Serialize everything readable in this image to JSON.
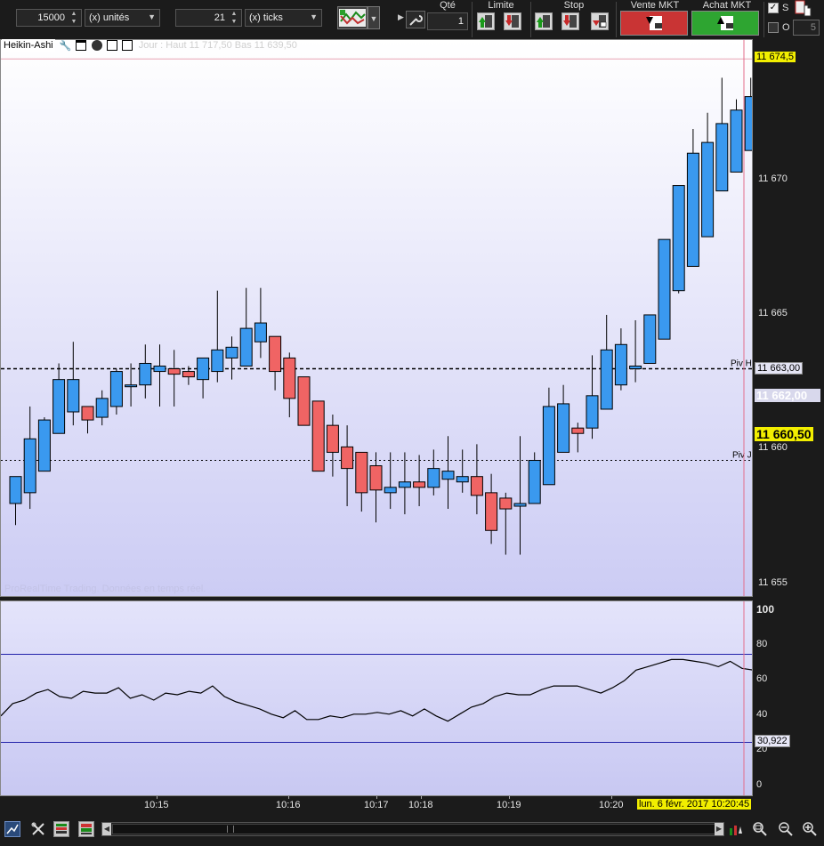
{
  "toolbar": {
    "quantity": "15000",
    "quantity_unit": "(x) unités",
    "ticks": "21",
    "ticks_unit": "(x) ticks",
    "qte_label": "Qté",
    "qte_value": "1",
    "limite_label": "Limite",
    "stop_label": "Stop",
    "vente_label": "Vente MKT",
    "achat_label": "Achat MKT",
    "s_label": "S",
    "o_label": "O",
    "o_value": "5"
  },
  "chart": {
    "indicator_title": "Heikin-Ashi",
    "header_info": "Jour : Haut 11 717,50  Bas 11 639,50",
    "watermark": "ProRealTime Trading. Données en temps réel.",
    "price_labels": [
      {
        "text": "11 674,5",
        "price": 11674.5,
        "style": "last-high"
      },
      {
        "text": "11 670",
        "price": 11670
      },
      {
        "text": "11 665",
        "price": 11665
      },
      {
        "text": "11 663,00",
        "price": 11663.0,
        "style": "pivot"
      },
      {
        "text": "11 662,00",
        "price": 11662.0,
        "style": "ghost"
      },
      {
        "text": "11 660,50",
        "price": 11660.5,
        "style": "current"
      },
      {
        "text": "11 660",
        "price": 11660
      },
      {
        "text": "11 655",
        "price": 11655
      }
    ],
    "pivot_high_label": "Piv H",
    "pivot_high_value": 11663.0,
    "pivot_low_label": "Piv J",
    "pivot_low_value": 11659.6,
    "osc_labels": [
      "100",
      "80",
      "60",
      "40",
      "20",
      "0"
    ],
    "osc_current": "30,922",
    "time_labels": [
      "10:15",
      "10:16",
      "10:17",
      "10:18",
      "10:19",
      "10:20"
    ],
    "current_time": "lun. 6 févr. 2017 10:20:45",
    "colors": {
      "up": "#3a99ef",
      "down": "#f06464",
      "pivot": "#000000",
      "cursor": "#e36d8b",
      "osc_line": "#000000",
      "osc_band": "#2222aa"
    }
  },
  "chart_data": {
    "type": "candlestick",
    "title": "Heikin-Ashi",
    "ylim": [
      11654.5,
      11675.2
    ],
    "candles": [
      {
        "o": 11658.0,
        "h": 11659.0,
        "l": 11657.2,
        "c": 11659.0
      },
      {
        "o": 11658.4,
        "h": 11661.6,
        "l": 11657.8,
        "c": 11660.4
      },
      {
        "o": 11659.2,
        "h": 11661.2,
        "l": 11659.2,
        "c": 11661.1
      },
      {
        "o": 11660.6,
        "h": 11663.2,
        "l": 11660.6,
        "c": 11662.6
      },
      {
        "o": 11661.4,
        "h": 11664.0,
        "l": 11660.9,
        "c": 11662.6
      },
      {
        "o": 11661.6,
        "h": 11661.6,
        "l": 11660.6,
        "c": 11661.1
      },
      {
        "o": 11661.2,
        "h": 11662.2,
        "l": 11660.9,
        "c": 11661.9
      },
      {
        "o": 11661.6,
        "h": 11663.0,
        "l": 11661.3,
        "c": 11662.9
      },
      {
        "o": 11662.4,
        "h": 11663.2,
        "l": 11661.6,
        "c": 11662.4
      },
      {
        "o": 11662.4,
        "h": 11663.9,
        "l": 11661.9,
        "c": 11663.2
      },
      {
        "o": 11662.9,
        "h": 11663.9,
        "l": 11661.6,
        "c": 11663.1
      },
      {
        "o": 11663.0,
        "h": 11663.7,
        "l": 11661.6,
        "c": 11662.8
      },
      {
        "o": 11662.9,
        "h": 11663.1,
        "l": 11662.4,
        "c": 11662.7
      },
      {
        "o": 11662.6,
        "h": 11663.3,
        "l": 11661.9,
        "c": 11663.4
      },
      {
        "o": 11662.9,
        "h": 11665.9,
        "l": 11662.5,
        "c": 11663.7
      },
      {
        "o": 11663.4,
        "h": 11664.2,
        "l": 11662.6,
        "c": 11663.8
      },
      {
        "o": 11663.1,
        "h": 11666.0,
        "l": 11663.1,
        "c": 11664.5
      },
      {
        "o": 11664.0,
        "h": 11666.0,
        "l": 11663.4,
        "c": 11664.7
      },
      {
        "o": 11664.2,
        "h": 11664.2,
        "l": 11662.2,
        "c": 11662.9
      },
      {
        "o": 11663.4,
        "h": 11663.6,
        "l": 11661.2,
        "c": 11661.9
      },
      {
        "o": 11662.7,
        "h": 11662.7,
        "l": 11660.9,
        "c": 11660.9
      },
      {
        "o": 11661.8,
        "h": 11661.8,
        "l": 11659.2,
        "c": 11659.2
      },
      {
        "o": 11660.9,
        "h": 11661.3,
        "l": 11659.0,
        "c": 11659.9
      },
      {
        "o": 11660.1,
        "h": 11660.9,
        "l": 11657.9,
        "c": 11659.3
      },
      {
        "o": 11659.9,
        "h": 11659.9,
        "l": 11657.7,
        "c": 11658.4
      },
      {
        "o": 11659.4,
        "h": 11659.9,
        "l": 11657.3,
        "c": 11658.5
      },
      {
        "o": 11658.4,
        "h": 11659.9,
        "l": 11657.8,
        "c": 11658.6
      },
      {
        "o": 11658.6,
        "h": 11659.9,
        "l": 11657.6,
        "c": 11658.8
      },
      {
        "o": 11658.8,
        "h": 11659.8,
        "l": 11657.9,
        "c": 11658.6
      },
      {
        "o": 11658.6,
        "h": 11660.0,
        "l": 11658.3,
        "c": 11659.3
      },
      {
        "o": 11658.9,
        "h": 11660.5,
        "l": 11657.8,
        "c": 11659.2
      },
      {
        "o": 11658.8,
        "h": 11660.0,
        "l": 11658.4,
        "c": 11659.0
      },
      {
        "o": 11659.0,
        "h": 11660.2,
        "l": 11657.6,
        "c": 11658.3
      },
      {
        "o": 11658.4,
        "h": 11659.1,
        "l": 11656.5,
        "c": 11657.0
      },
      {
        "o": 11658.2,
        "h": 11658.4,
        "l": 11656.1,
        "c": 11657.8
      },
      {
        "o": 11657.9,
        "h": 11660.5,
        "l": 11656.1,
        "c": 11658.0
      },
      {
        "o": 11658.0,
        "h": 11659.9,
        "l": 11658.0,
        "c": 11659.6
      },
      {
        "o": 11658.7,
        "h": 11662.3,
        "l": 11658.7,
        "c": 11661.6
      },
      {
        "o": 11659.9,
        "h": 11662.4,
        "l": 11659.9,
        "c": 11661.7
      },
      {
        "o": 11660.8,
        "h": 11661.0,
        "l": 11659.9,
        "c": 11660.6
      },
      {
        "o": 11660.8,
        "h": 11663.5,
        "l": 11660.4,
        "c": 11662.0
      },
      {
        "o": 11661.5,
        "h": 11665.0,
        "l": 11661.5,
        "c": 11663.7
      },
      {
        "o": 11662.4,
        "h": 11664.5,
        "l": 11662.2,
        "c": 11663.9
      },
      {
        "o": 11663.0,
        "h": 11664.8,
        "l": 11662.5,
        "c": 11663.1
      },
      {
        "o": 11663.2,
        "h": 11665.0,
        "l": 11663.2,
        "c": 11665.0
      },
      {
        "o": 11664.1,
        "h": 11667.3,
        "l": 11664.1,
        "c": 11667.8
      },
      {
        "o": 11665.9,
        "h": 11668.5,
        "l": 11665.8,
        "c": 11669.8
      },
      {
        "o": 11666.8,
        "h": 11671.9,
        "l": 11666.8,
        "c": 11671.0
      },
      {
        "o": 11667.9,
        "h": 11672.5,
        "l": 11667.9,
        "c": 11671.4
      },
      {
        "o": 11669.6,
        "h": 11673.8,
        "l": 11669.6,
        "c": 11672.1
      },
      {
        "o": 11670.3,
        "h": 11673.0,
        "l": 11670.3,
        "c": 11672.6
      },
      {
        "o": 11671.1,
        "h": 11673.8,
        "l": 11671.1,
        "c": 11673.1
      },
      {
        "o": 11672.1,
        "h": 11674.3,
        "l": 11671.7,
        "c": 11672.6
      },
      {
        "o": 11672.2,
        "h": 11674.4,
        "l": 11672.1,
        "c": 11673.0
      }
    ],
    "oscillator": {
      "ylim": [
        0,
        100
      ],
      "levels": [
        75,
        25
      ],
      "values": [
        40,
        47,
        49,
        53,
        55,
        51,
        50,
        54,
        53,
        53,
        56,
        50,
        52,
        49,
        53,
        52,
        54,
        53,
        57,
        51,
        48,
        46,
        44,
        41,
        39,
        43,
        38,
        38,
        40,
        39,
        41,
        41,
        42,
        41,
        43,
        40,
        44,
        40,
        37,
        41,
        45,
        47,
        51,
        53,
        52,
        52,
        55,
        57,
        57,
        57,
        55,
        53,
        56,
        60,
        66,
        68,
        70,
        72,
        72,
        71,
        70,
        68,
        71,
        67,
        66
      ]
    }
  }
}
